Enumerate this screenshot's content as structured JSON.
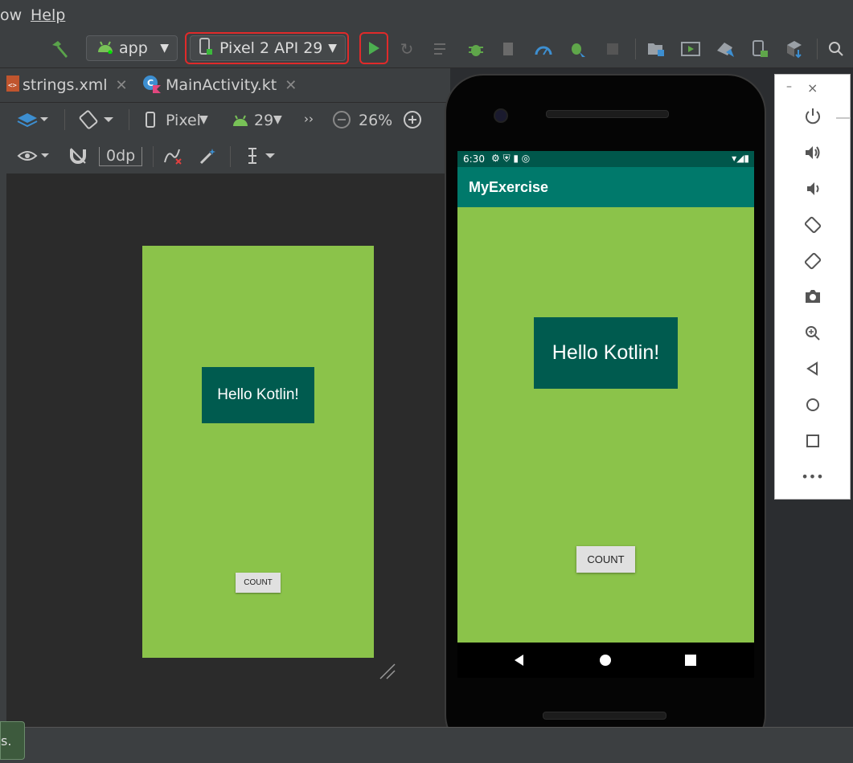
{
  "menu": {
    "window_partial": "ow",
    "help": "Help"
  },
  "toolbar": {
    "module": "app",
    "device": "Pixel 2 API 29",
    "colors": {
      "run": "#4caf50",
      "highlight_border": "#e02a2a",
      "android_green": "#78c257"
    }
  },
  "tabs": [
    {
      "label": "strings.xml",
      "icon": "xml-file-icon"
    },
    {
      "label": "MainActivity.kt",
      "icon": "kotlin-file-icon"
    }
  ],
  "design_toolbar": {
    "device": "Pixel",
    "api": "29",
    "more": "››",
    "zoom": "26%",
    "margin": "0dp"
  },
  "preview": {
    "text": "Hello Kotlin!",
    "button": "COUNT",
    "colors": {
      "background": "#8bc34a",
      "text_bg": "#005b4f"
    }
  },
  "emulator": {
    "time": "6:30",
    "app_title": "MyExercise",
    "text": "Hello Kotlin!",
    "button": "COUNT",
    "colors": {
      "status": "#00574b",
      "app_bar": "#00796b",
      "background": "#8bc34a",
      "text_bg": "#005b4f"
    }
  },
  "emulator_panel": {
    "minimize": "–",
    "close": "×",
    "icons": [
      "power-icon",
      "volume-up-icon",
      "volume-down-icon",
      "rotate-left-icon",
      "rotate-right-icon",
      "camera-icon",
      "zoom-icon",
      "back-icon",
      "home-icon",
      "overview-icon",
      "more-icon"
    ]
  },
  "status_bar": {
    "text": "s."
  }
}
